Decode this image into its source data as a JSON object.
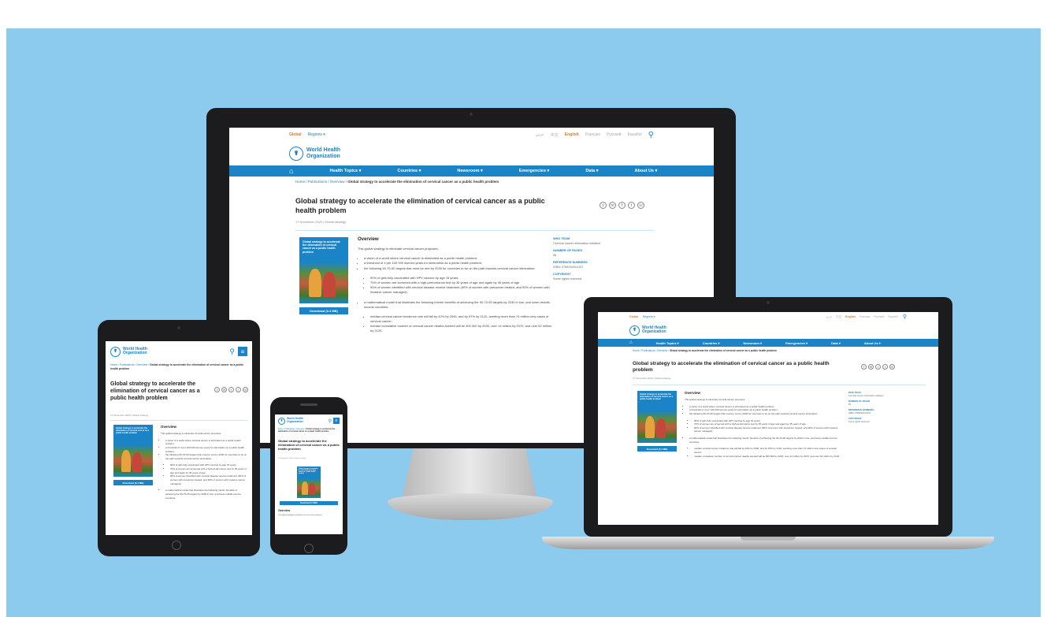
{
  "site": {
    "top": {
      "home": "Global",
      "regions": "Regions ▾"
    },
    "langs": [
      "عربي",
      "中文",
      "English",
      "Français",
      "Русский",
      "Español"
    ],
    "logo": {
      "line1": "World Health",
      "line2": "Organization"
    },
    "nav": [
      "Health Topics ▾",
      "Countries ▾",
      "Newsroom ▾",
      "Emergencies ▾",
      "Data ▾",
      "About Us ▾"
    ],
    "breadcrumb": {
      "links": "Home / Publications / Overview / ",
      "current": "Global strategy to accelerate the elimination of cervical cancer as a public health problem"
    },
    "title": "Global strategy to accelerate the elimination of cervical cancer as a public health problem",
    "date": "17 November 2020 | Global strategy",
    "cover_text": "Global strategy to accelerate the elimination of cervical cancer as a public health problem",
    "download": "Download (3.4 MB)",
    "overview_heading": "Overview",
    "intro": "This global strategy to eliminate cervical cancer proposes:",
    "bullets": [
      "a vision of a world where cervical cancer is eliminated as a public health problem;",
      "a threshold of 4 per 100 000 women-years for elimination as a public health problem;",
      "the following 90-70-90 targets that must be met by 2030 for countries to be on the path towards cervical cancer elimination:"
    ],
    "sub_bullets": [
      "90% of girls fully vaccinated with HPV vaccine by age 15 years;",
      "70% of women are screened with a high-performance test by 35 years of age and again by 45 years of age",
      "90% of women identified with cervical disease receive treatment (90% of women with precancer treated, and 90% of women with invasive cancer managed)."
    ],
    "model_bullet": "a mathematical model that illustrates the following interim benefits of achieving the 90-70-90 targets by 2030 in low- and lower-middle-income countries:",
    "model_sub": [
      "median cervical cancer incidence rate will fall by 42% by 2045, and by 97% by 2120, averting more than 74 million new cases of cervical cancer;",
      "median cumulative number of cervical cancer deaths averted will be 300 000 by 2030, over 14 million by 2070, and over 62 million by 2120."
    ],
    "sidebar": [
      {
        "label": "WHO Team",
        "value": "Cervical cancer elimination initiative"
      },
      {
        "label": "Number of pages",
        "value": "56"
      },
      {
        "label": "Reference numbers",
        "value": "ISBN: 9789240014107"
      },
      {
        "label": "Copyright",
        "value": "Some rights reserved"
      }
    ]
  },
  "icons": [
    "search-icon",
    "home-icon",
    "menu-icon",
    "share-icon",
    "email-icon",
    "facebook-icon",
    "twitter-icon",
    "whatsapp-icon"
  ],
  "colors": {
    "background": "#8ccbee",
    "brand_blue": "#1a84c7",
    "accent_orange": "#e07a1f",
    "device_black": "#1c1c1e"
  }
}
